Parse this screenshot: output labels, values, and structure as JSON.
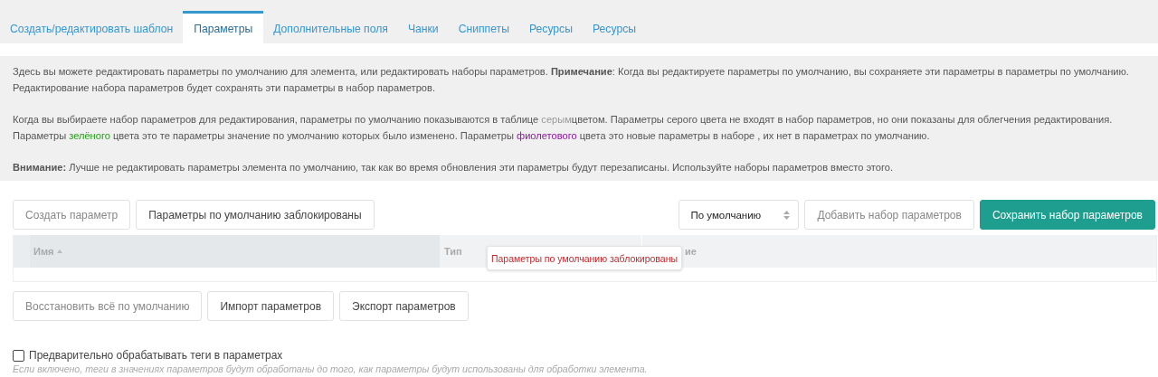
{
  "tabs": [
    {
      "label": "Создать/редактировать шаблон",
      "selected": false
    },
    {
      "label": "Параметры",
      "selected": true
    },
    {
      "label": "Дополнительные поля",
      "selected": false
    },
    {
      "label": "Чанки",
      "selected": false
    },
    {
      "label": "Сниппеты",
      "selected": false
    },
    {
      "label": "Ресурсы",
      "selected": false
    },
    {
      "label": "Ресурсы",
      "selected": false
    }
  ],
  "info": {
    "paragraphs": [
      [
        {
          "kind": "text",
          "text": "Здесь вы можете редактировать параметры по умолчанию для элемента, или редактировать наборы параметров. "
        },
        {
          "kind": "bold",
          "text": "Примечание"
        },
        {
          "kind": "text",
          "text": ": Когда вы редактируете параметры по умолчанию, вы сохраняете эти параметры в параметры по умолчанию. Редактирование набора параметров будет сохранять эти параметры в набор параметров."
        }
      ],
      [
        {
          "kind": "text",
          "text": "Когда вы выбираете набор параметров для редактирования, параметры по умолчанию показываются в таблице "
        },
        {
          "kind": "gray",
          "text": "серым"
        },
        {
          "kind": "text",
          "text": "цветом. Параметры серого цвета не входят в набор параметров, но они показаны для облегчения редактирования. Параметры "
        },
        {
          "kind": "green",
          "text": "зелёного"
        },
        {
          "kind": "text",
          "text": " цвета это те параметры значение по умолчанию которых было изменено. Параметры "
        },
        {
          "kind": "purple",
          "text": "фиолетового"
        },
        {
          "kind": "text",
          "text": " цвета это новые параметры в наборе , их нет в параметрах по умолчанию."
        }
      ],
      [
        {
          "kind": "bold",
          "text": "Внимание:"
        },
        {
          "kind": "text",
          "text": " Лучше не редактировать параметры элемента по умолчанию, так как во время обновления эти параметры будут перезаписаны. Используйте наборы параметров вместо этого."
        }
      ]
    ]
  },
  "toolbar": {
    "left_buttons": [
      {
        "label": "Создать параметр",
        "disabled": true
      },
      {
        "label": "Параметры по умолчанию заблокированы",
        "disabled": false
      }
    ],
    "select": {
      "value": "По умолчанию"
    },
    "right_buttons": [
      {
        "label": "Добавить набор параметров",
        "kind": "default",
        "disabled": true
      },
      {
        "label": "Сохранить набор параметров",
        "kind": "primary",
        "disabled": false
      }
    ]
  },
  "table": {
    "columns": [
      {
        "label": "Имя",
        "sorted": true
      },
      {
        "label": "Тип",
        "sorted": false
      },
      {
        "label": "ие",
        "sorted": false
      }
    ]
  },
  "tooltip": {
    "text": "Параметры по умолчанию заблокированы"
  },
  "bottom_buttons": [
    {
      "label": "Восстановить всё по умолчанию",
      "disabled": true
    },
    {
      "label": "Импорт параметров",
      "disabled": false
    },
    {
      "label": "Экспорт параметров",
      "disabled": false
    }
  ],
  "option": {
    "label": "Предварительно обрабатывать теги в параметрах",
    "checked": false,
    "hint": "Если включено, теги в значениях параметров будут обработаны до того, как параметры будут использованы для обработки элемента."
  }
}
